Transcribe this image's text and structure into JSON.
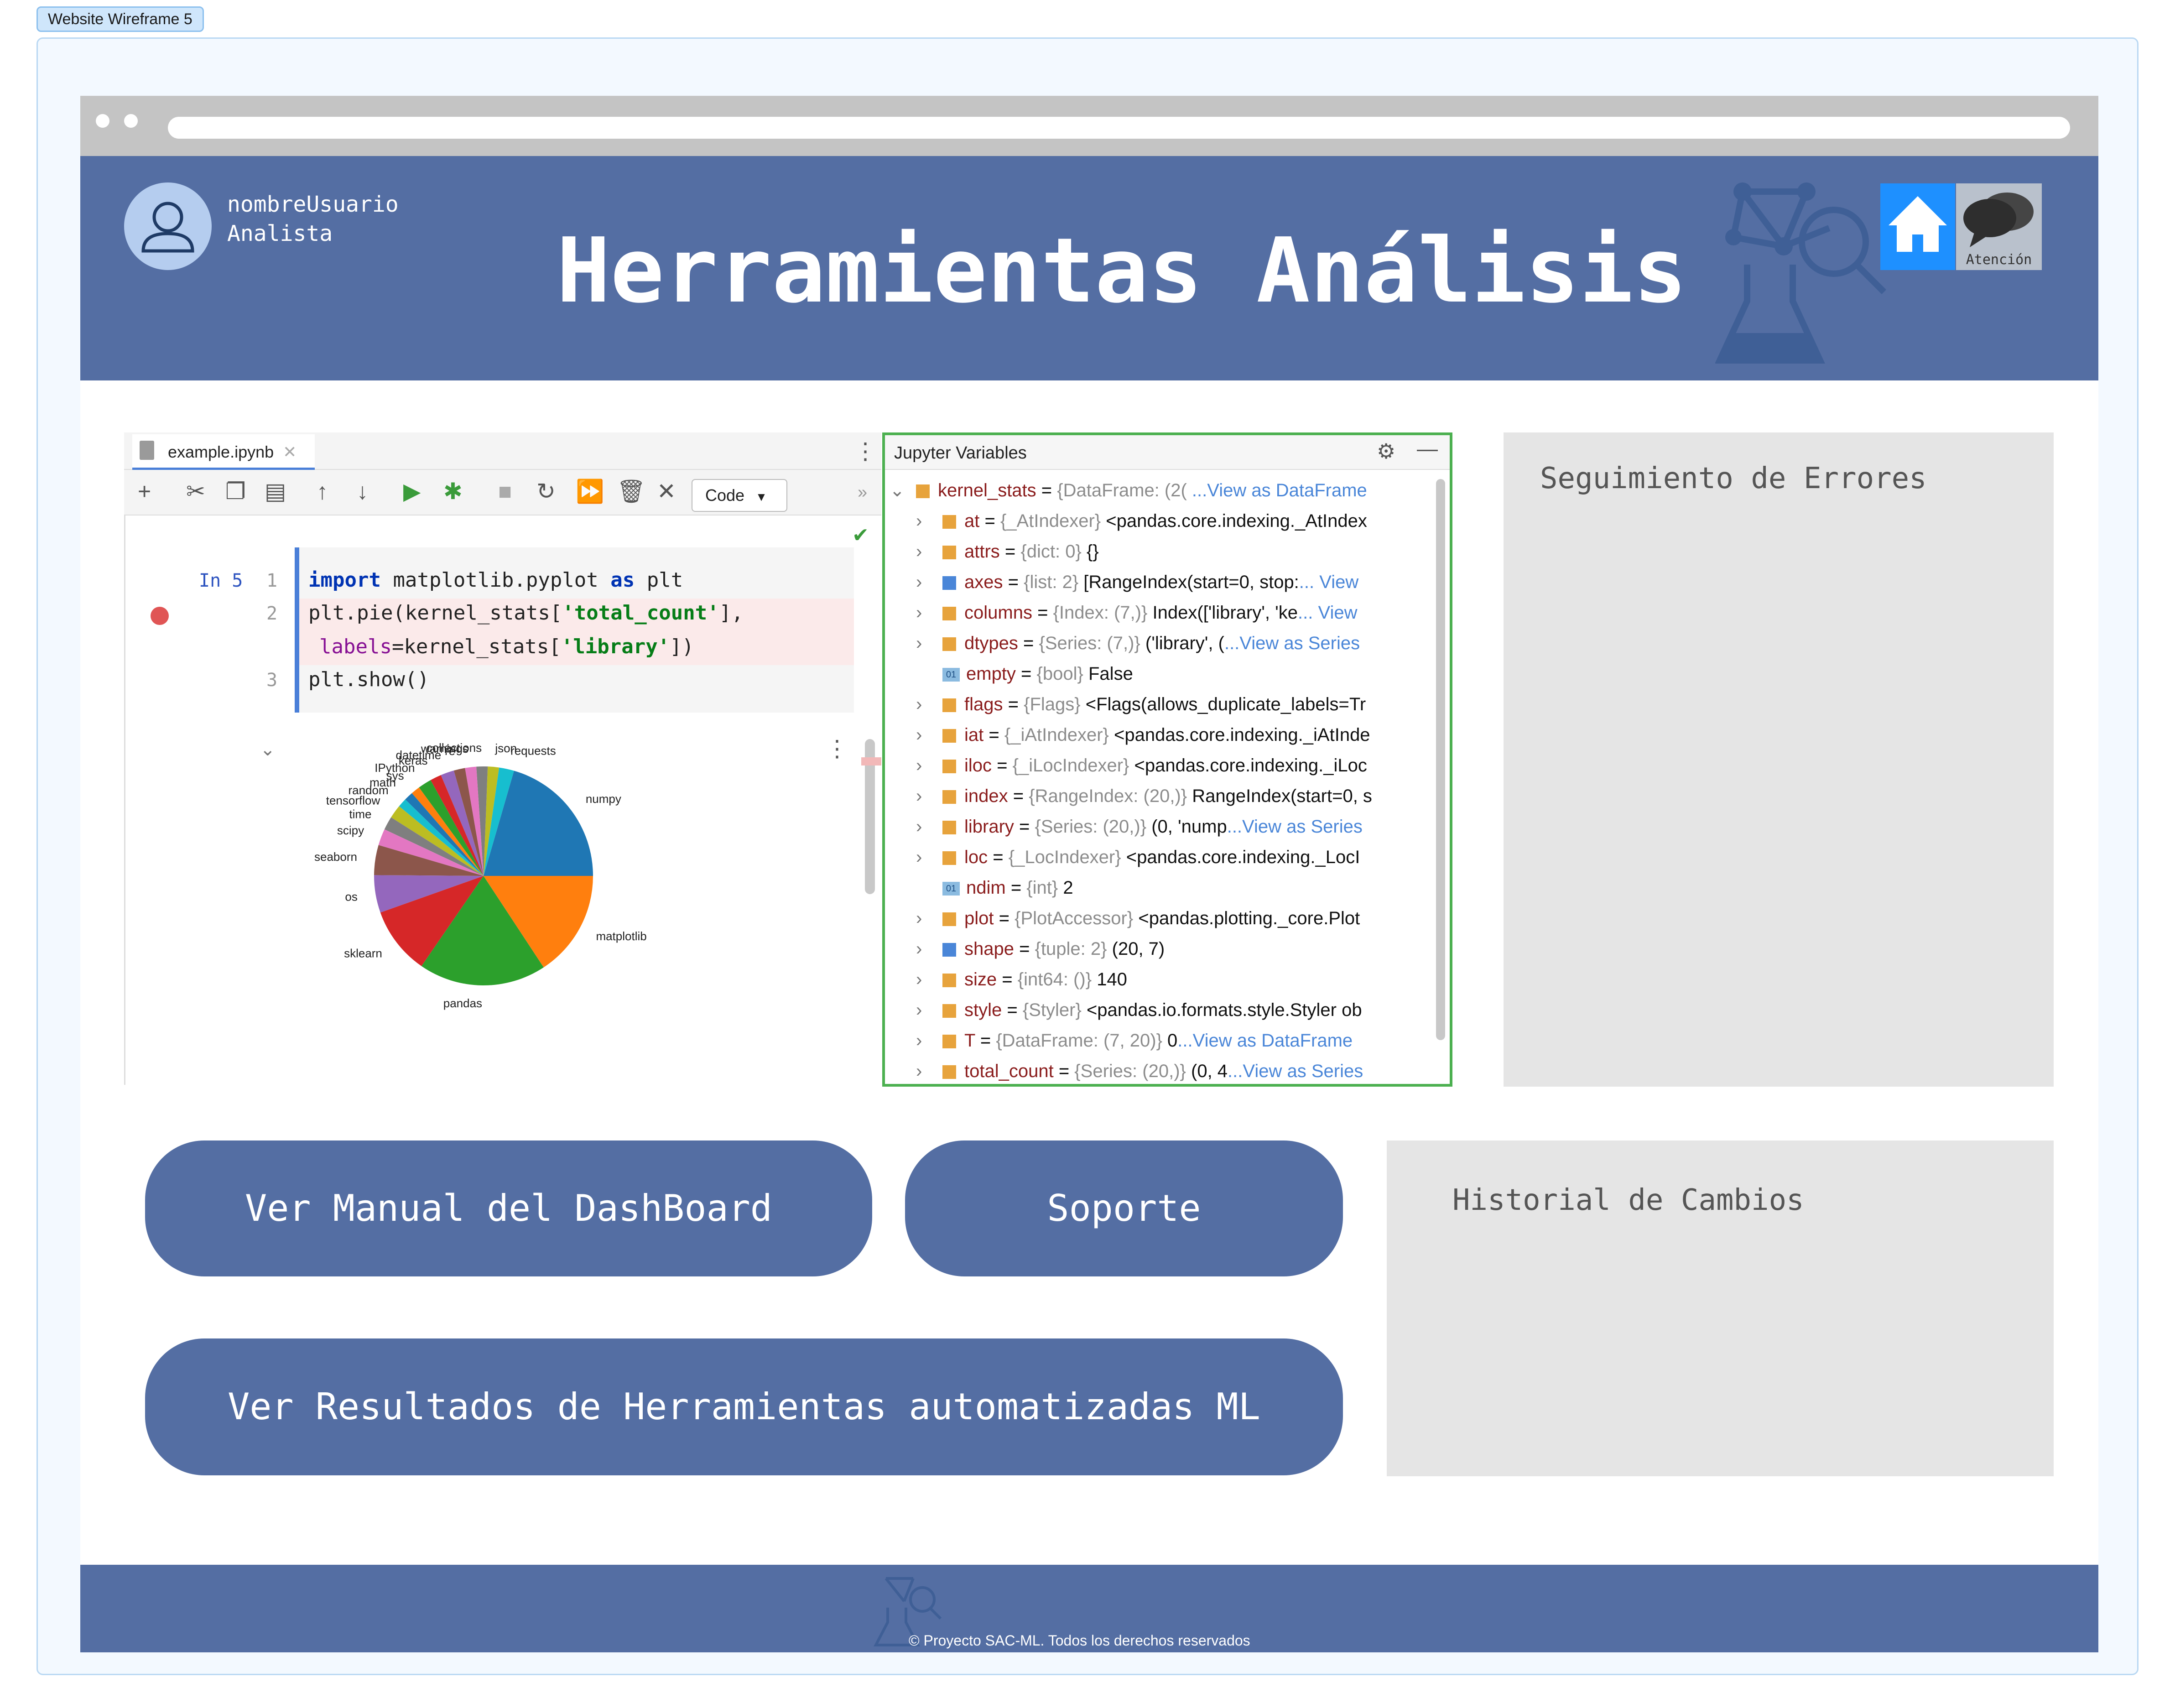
{
  "frame_tag": "Website Wireframe 5",
  "user": {
    "name": "nombreUsuario",
    "role": "Analista"
  },
  "header": {
    "title": "Herramientas Análisis",
    "attention_label": "Atención"
  },
  "notebook": {
    "tab_label": "example.ipynb",
    "cell_type": "Code",
    "prompt": "In 5",
    "line_numbers": [
      "1",
      "2",
      "3"
    ],
    "code": {
      "l1_kw": "import",
      "l1_mod": " matplotlib.pyplot ",
      "l1_as": "as",
      "l1_alias": " plt",
      "l2_a": "plt.pie(kernel_stats[",
      "l2_str": "'total_count'",
      "l2_b": "],",
      "l2c_arg": "labels",
      "l2c_a": "=kernel_stats[",
      "l2c_str": "'library'",
      "l2c_b": "])",
      "l3": "plt.show()"
    }
  },
  "chart_data": {
    "type": "pie",
    "labels": [
      "numpy",
      "requests",
      "json",
      "collections",
      "warnings",
      "re",
      "datetime",
      "keras",
      "IPython",
      "sys",
      "math",
      "random",
      "tensorflow",
      "time",
      "scipy",
      "seaborn",
      "os",
      "sklearn",
      "pandas",
      "matplotlib"
    ],
    "values": [
      18.5,
      2,
      1.5,
      1.5,
      1.5,
      1.5,
      1.8,
      1.5,
      1.8,
      1.2,
      1.2,
      1.2,
      1.8,
      1.8,
      2.2,
      4,
      5,
      9,
      17,
      14.2
    ],
    "colors": [
      "#1f77b4",
      "#17becf",
      "#bcbd22",
      "#7f7f7f",
      "#e377c2",
      "#8c564b",
      "#9467bd",
      "#d62728",
      "#2ca02c",
      "#ff7f0e",
      "#1f77b4",
      "#17becf",
      "#bcbd22",
      "#7f7f7f",
      "#e377c2",
      "#8c564b",
      "#9467bd",
      "#d62728",
      "#2ca02c",
      "#ff7f0e"
    ]
  },
  "variables": {
    "title": "Jupyter Variables",
    "rows": [
      {
        "chev": "⌄",
        "icon": "frame",
        "name": "kernel_stats",
        "type": "{DataFrame: (2(",
        "value": "",
        "link": "...View as DataFrame"
      },
      {
        "chev": "›",
        "icon": "frame",
        "name": "at",
        "type": "{_AtIndexer}",
        "value": "<pandas.core.indexing._AtIndex",
        "link": ""
      },
      {
        "chev": "›",
        "icon": "frame",
        "name": "attrs",
        "type": "{dict: 0}",
        "value": "{}",
        "link": ""
      },
      {
        "chev": "›",
        "icon": "list",
        "name": "axes",
        "type": "{list: 2}",
        "value": "[RangeIndex(start=0, stop:",
        "link": "... View"
      },
      {
        "chev": "›",
        "icon": "frame",
        "name": "columns",
        "type": "{Index: (7,)}",
        "value": "Index(['library', 'ke",
        "link": "... View"
      },
      {
        "chev": "›",
        "icon": "frame",
        "name": "dtypes",
        "type": "{Series: (7,)}",
        "value": "('library', (",
        "link": "...View as Series"
      },
      {
        "chev": "",
        "icon": "bool",
        "name": "empty",
        "type": "{bool}",
        "value": "False",
        "link": ""
      },
      {
        "chev": "›",
        "icon": "frame",
        "name": "flags",
        "type": "{Flags}",
        "value": "<Flags(allows_duplicate_labels=Tr",
        "link": ""
      },
      {
        "chev": "›",
        "icon": "frame",
        "name": "iat",
        "type": "{_iAtIndexer}",
        "value": "<pandas.core.indexing._iAtInde",
        "link": ""
      },
      {
        "chev": "›",
        "icon": "frame",
        "name": "iloc",
        "type": "{_iLocIndexer}",
        "value": "<pandas.core.indexing._iLoc",
        "link": ""
      },
      {
        "chev": "›",
        "icon": "frame",
        "name": "index",
        "type": "{RangeIndex: (20,)}",
        "value": "RangeIndex(start=0, s",
        "link": ""
      },
      {
        "chev": "›",
        "icon": "frame",
        "name": "library",
        "type": "{Series: (20,)}",
        "value": "(0, 'nump",
        "link": "...View as Series"
      },
      {
        "chev": "›",
        "icon": "frame",
        "name": "loc",
        "type": "{_LocIndexer}",
        "value": "<pandas.core.indexing._LocI",
        "link": ""
      },
      {
        "chev": "",
        "icon": "bool",
        "name": "ndim",
        "type": "{int}",
        "value": "2",
        "link": ""
      },
      {
        "chev": "›",
        "icon": "frame",
        "name": "plot",
        "type": "{PlotAccessor}",
        "value": "<pandas.plotting._core.Plot",
        "link": ""
      },
      {
        "chev": "›",
        "icon": "list",
        "name": "shape",
        "type": "{tuple: 2}",
        "value": "(20, 7)",
        "link": ""
      },
      {
        "chev": "›",
        "icon": "frame",
        "name": "size",
        "type": "{int64: ()}",
        "value": "140",
        "link": ""
      },
      {
        "chev": "›",
        "icon": "frame",
        "name": "style",
        "type": "{Styler}",
        "value": "<pandas.io.formats.style.Styler ob",
        "link": ""
      },
      {
        "chev": "›",
        "icon": "frame",
        "name": "T",
        "type": "{DataFrame: (7, 20)}",
        "value": "0",
        "link": "...View as DataFrame"
      },
      {
        "chev": "›",
        "icon": "frame",
        "name": "total_count",
        "type": "{Series: (20,)}",
        "value": "(0, 4",
        "link": "...View as Series"
      }
    ]
  },
  "panels": {
    "errors_title": "Seguimiento de Errores",
    "history_title": "Historial de Cambios"
  },
  "buttons": {
    "manual": "Ver Manual del DashBoard",
    "support": "Soporte",
    "ml_results": "Ver Resultados de Herramientas automatizadas ML"
  },
  "footer": {
    "text": "© Proyecto SAC-ML. Todos los derechos reservados"
  }
}
